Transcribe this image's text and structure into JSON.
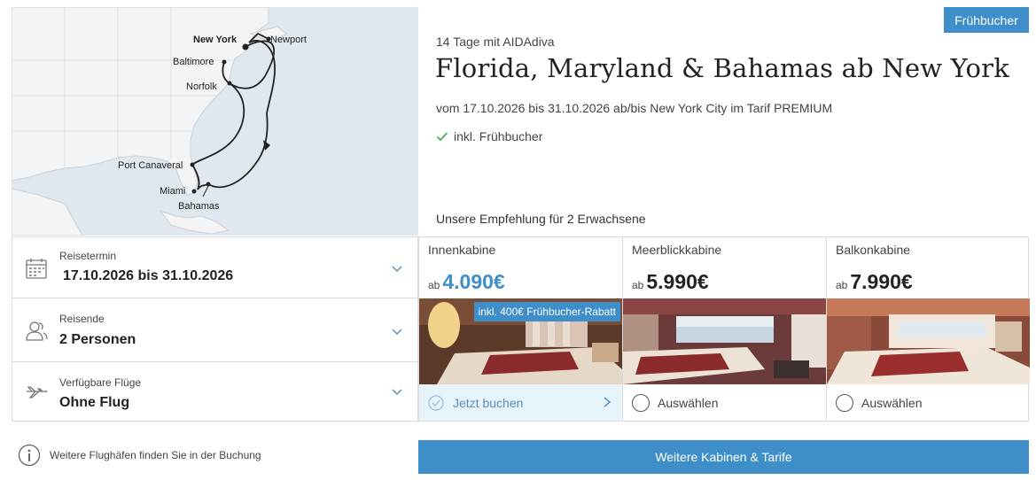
{
  "map": {
    "ports": [
      "New York",
      "Newport",
      "Baltimore",
      "Norfolk",
      "Port Canaveral",
      "Miami",
      "Bahamas"
    ]
  },
  "badge": "Frühbucher",
  "cruise": {
    "subtitle": "14 Tage mit AIDAdiva",
    "title": "Florida, Maryland & Bahamas ab New York",
    "dates_line": "vom 17.10.2026 bis 31.10.2026 ab/bis New York City im Tarif PREMIUM",
    "inclusion": "inkl. Frühbucher",
    "recommendation": "Unsere Empfehlung für 2 Erwachsene"
  },
  "booking": {
    "travel_date": {
      "label": "Reisetermin",
      "value": "17.10.2026 bis 31.10.2026",
      "icon": "calendar-icon"
    },
    "travelers": {
      "label": "Reisende",
      "value": "2 Personen",
      "icon": "users-icon"
    },
    "flights": {
      "label": "Verfügbare Flüge",
      "value": "Ohne Flug",
      "icon": "plane-icon"
    }
  },
  "cabins": [
    {
      "name": "Innenkabine",
      "prefix": "ab",
      "price": "4.090€",
      "badge": "inkl. 400€ Frühbucher-Rabatt",
      "action": "Jetzt buchen",
      "selected": true
    },
    {
      "name": "Meerblickkabine",
      "prefix": "ab",
      "price": "5.990€",
      "action": "Auswählen",
      "selected": false
    },
    {
      "name": "Balkonkabine",
      "prefix": "ab",
      "price": "7.990€",
      "action": "Auswählen",
      "selected": false
    }
  ],
  "info": {
    "text": "Weitere Flughäfen finden Sie in der Buchung",
    "icon": "info-icon"
  },
  "more_button": "Weitere Kabinen & Tarife",
  "colors": {
    "accent": "#3d8ec9",
    "selected_bg": "#e6f3fb",
    "map_water": "#dfe8ef",
    "map_land": "#f4f4f4"
  }
}
